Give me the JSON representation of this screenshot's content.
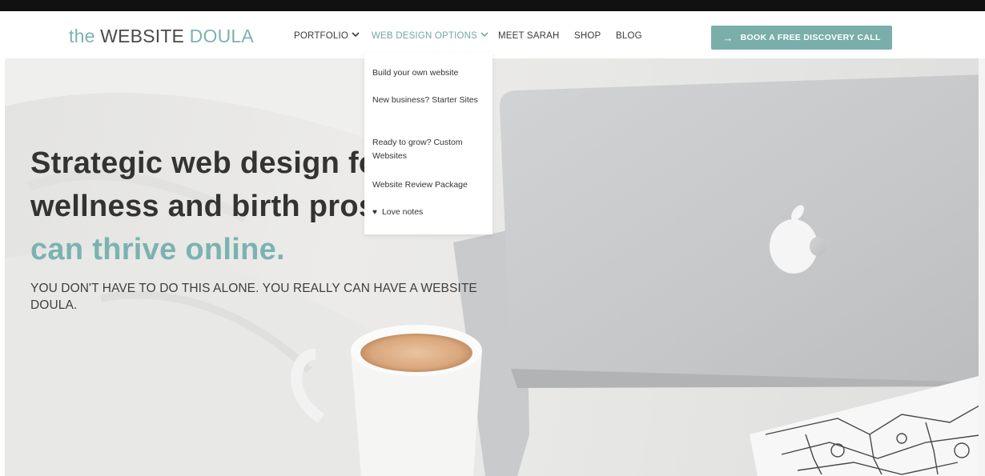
{
  "brand": {
    "logo_part1": "the ",
    "logo_part2": "WEBSITE",
    "logo_part3": " DOULA",
    "accent_color": "#7ab3b0",
    "dark_color": "#4a4a4a"
  },
  "nav": {
    "items": [
      {
        "label": "PORTFOLIO",
        "icon": "chevron-down-icon"
      },
      {
        "label": "WEB DESIGN OPTIONS",
        "icon": "chevron-down-icon",
        "active": true
      },
      {
        "label": "MEET SARAH"
      },
      {
        "label": "SHOP"
      },
      {
        "label": "BLOG"
      }
    ],
    "cta_label": "BOOK A FREE DISCOVERY CALL",
    "cta_icon": "arrow-right-icon"
  },
  "dropdown": {
    "items": [
      {
        "label": "Build your own website"
      },
      {
        "label": "New business? Starter Sites"
      },
      {
        "label": "Ready to grow? Custom Websites"
      },
      {
        "label": "Website Review Package"
      },
      {
        "label": "Love notes",
        "icon": "heart-icon"
      }
    ]
  },
  "hero": {
    "headline_line1": "Strategic web design for",
    "headline_line2": "wellness and birth pros so you",
    "headline_line3": "can thrive online.",
    "subhead": "YOU DON'T HAVE TO DO THIS ALONE. YOU REALLY CAN HAVE A WEBSITE DOULA."
  }
}
